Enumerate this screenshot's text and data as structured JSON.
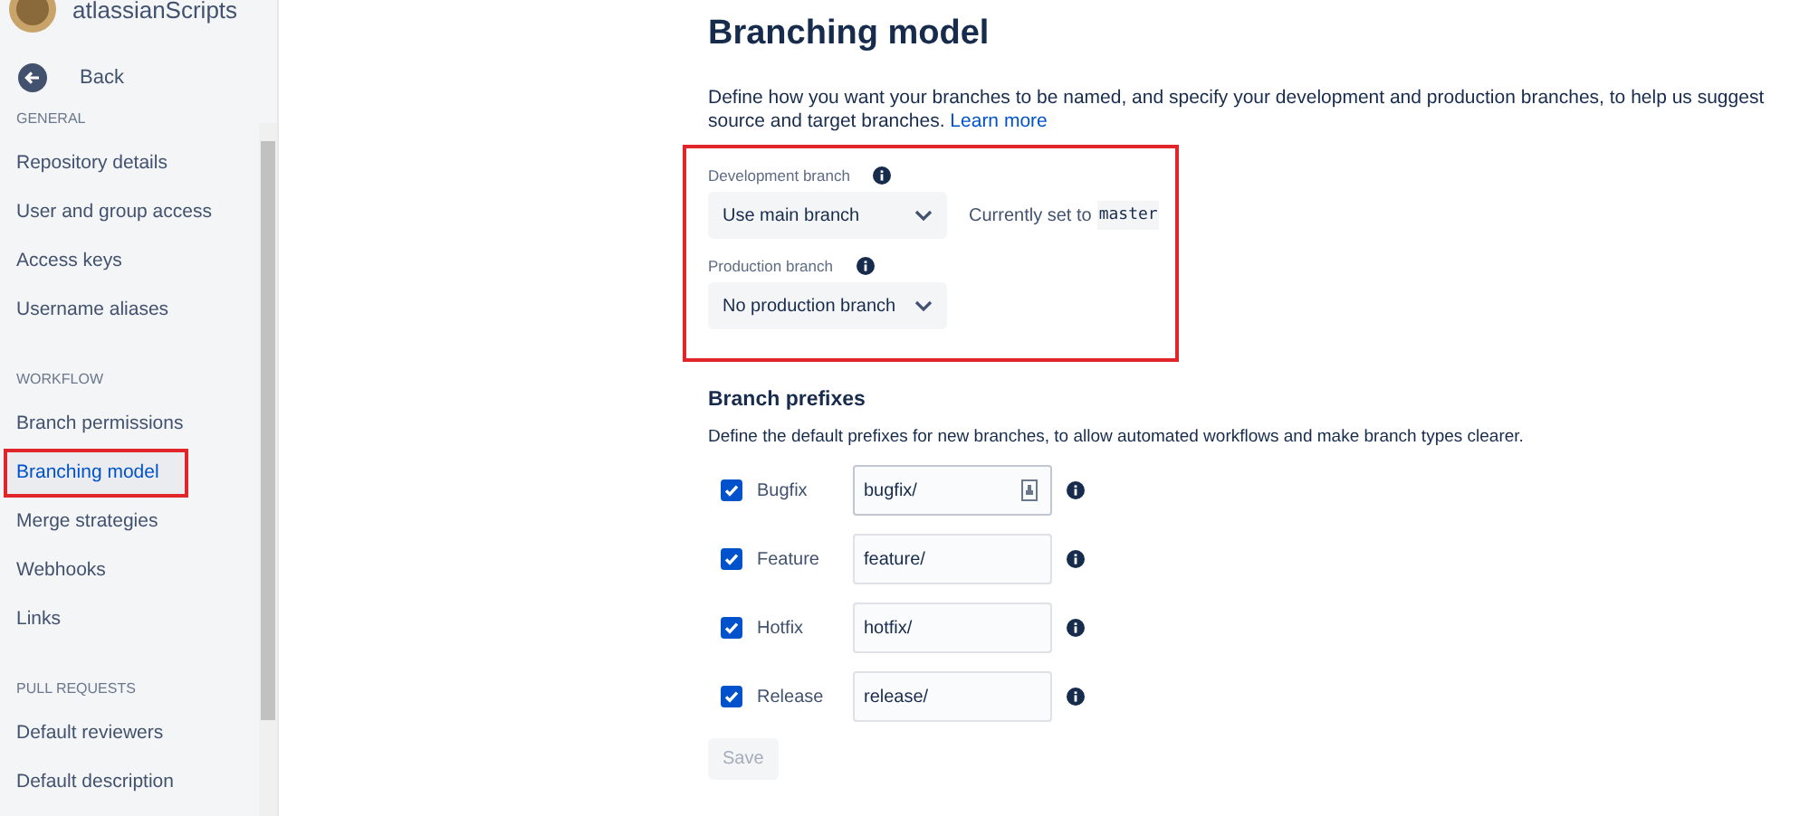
{
  "sidebar": {
    "account": "atlassianScripts",
    "back": "Back",
    "sections": [
      {
        "heading": "GENERAL",
        "items": [
          {
            "label": "Repository details",
            "selected": false,
            "highlighted": false
          },
          {
            "label": "User and group access",
            "selected": false,
            "highlighted": false
          },
          {
            "label": "Access keys",
            "selected": false,
            "highlighted": false
          },
          {
            "label": "Username aliases",
            "selected": false,
            "highlighted": false
          }
        ]
      },
      {
        "heading": "WORKFLOW",
        "items": [
          {
            "label": "Branch permissions",
            "selected": false,
            "highlighted": false
          },
          {
            "label": "Branching model",
            "selected": true,
            "highlighted": true
          },
          {
            "label": "Merge strategies",
            "selected": false,
            "highlighted": false
          },
          {
            "label": "Webhooks",
            "selected": false,
            "highlighted": false
          },
          {
            "label": "Links",
            "selected": false,
            "highlighted": false
          }
        ]
      },
      {
        "heading": "PULL REQUESTS",
        "items": [
          {
            "label": "Default reviewers",
            "selected": false,
            "highlighted": false
          },
          {
            "label": "Default description",
            "selected": false,
            "highlighted": false
          }
        ]
      }
    ]
  },
  "page": {
    "title": "Branching model",
    "description": "Define how you want your branches to be named, and specify your development and production branches, to help us suggest source and target branches.",
    "learn_more": "Learn more",
    "branches": {
      "highlighted": true,
      "development": {
        "label": "Development branch",
        "value": "Use main branch",
        "note": "Currently set to",
        "current": "master"
      },
      "production": {
        "label": "Production branch",
        "value": "No production branch"
      }
    },
    "prefixes": {
      "title": "Branch prefixes",
      "description": "Define the default prefixes for new branches, to allow automated workflows and make branch types clearer.",
      "rows": [
        {
          "label": "Bugfix",
          "checked": true,
          "value": "bugfix/",
          "focused": true
        },
        {
          "label": "Feature",
          "checked": true,
          "value": "feature/",
          "focused": false
        },
        {
          "label": "Hotfix",
          "checked": true,
          "value": "hotfix/",
          "focused": false
        },
        {
          "label": "Release",
          "checked": true,
          "value": "release/",
          "focused": false
        }
      ]
    },
    "save": {
      "label": "Save",
      "disabled": true
    }
  }
}
